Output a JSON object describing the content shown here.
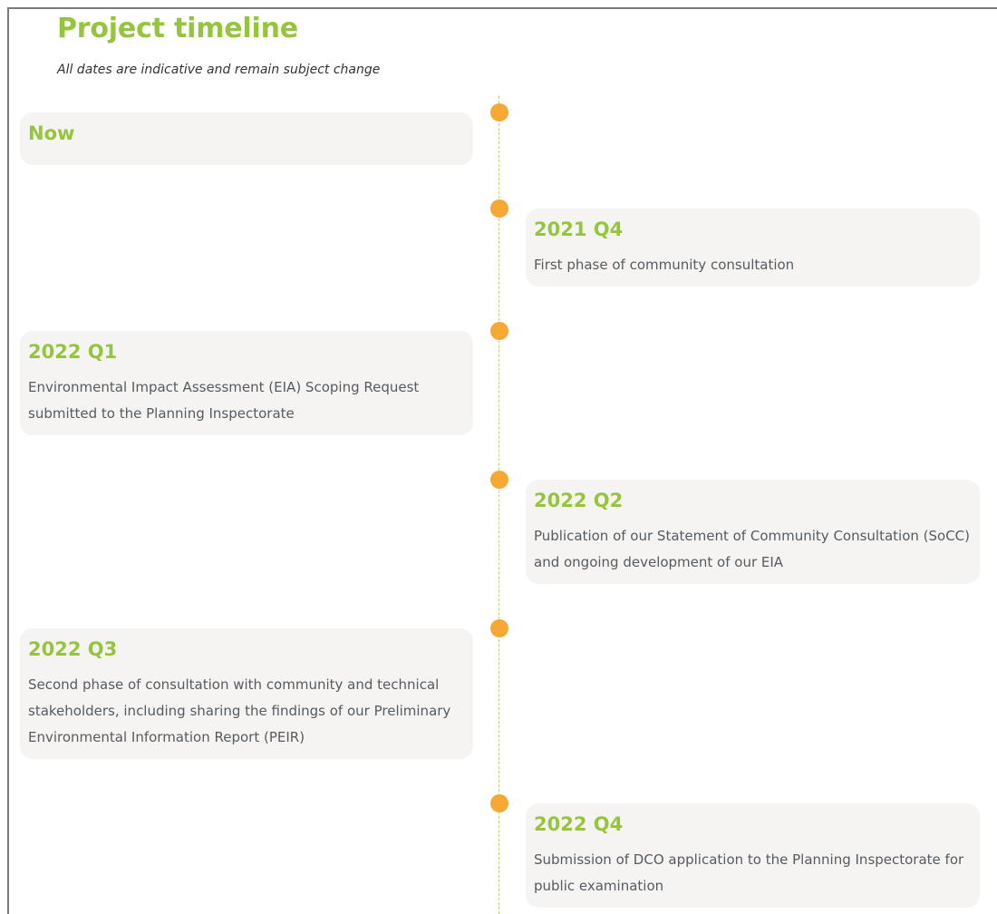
{
  "page": {
    "title": "Project timeline",
    "subtitle": "All dates are indicative and remain subject change"
  },
  "colors": {
    "heading_green": "#95c43d",
    "marker_orange": "#f5a833",
    "card_background": "#f6f4f3",
    "body_text": "#555b60"
  },
  "timeline": [
    {
      "heading": "Now",
      "text": "",
      "side": "left"
    },
    {
      "heading": "2021 Q4",
      "text": "First phase of community consultation",
      "side": "right"
    },
    {
      "heading": "2022 Q1",
      "text": "Environmental Impact Assessment (EIA) Scoping Request submitted to the Planning Inspectorate",
      "side": "left"
    },
    {
      "heading": "2022 Q2",
      "text": "Publication of our Statement of Community Consultation (SoCC) and ongoing development of our EIA",
      "side": "right"
    },
    {
      "heading": "2022 Q3",
      "text": "Second phase of consultation with community and technical stakeholders, including sharing the findings of our Preliminary Environmental Information Report (PEIR)",
      "side": "left"
    },
    {
      "heading": "2022 Q4",
      "text": "Submission of DCO application to the Planning Inspectorate for public examination",
      "side": "right"
    }
  ]
}
